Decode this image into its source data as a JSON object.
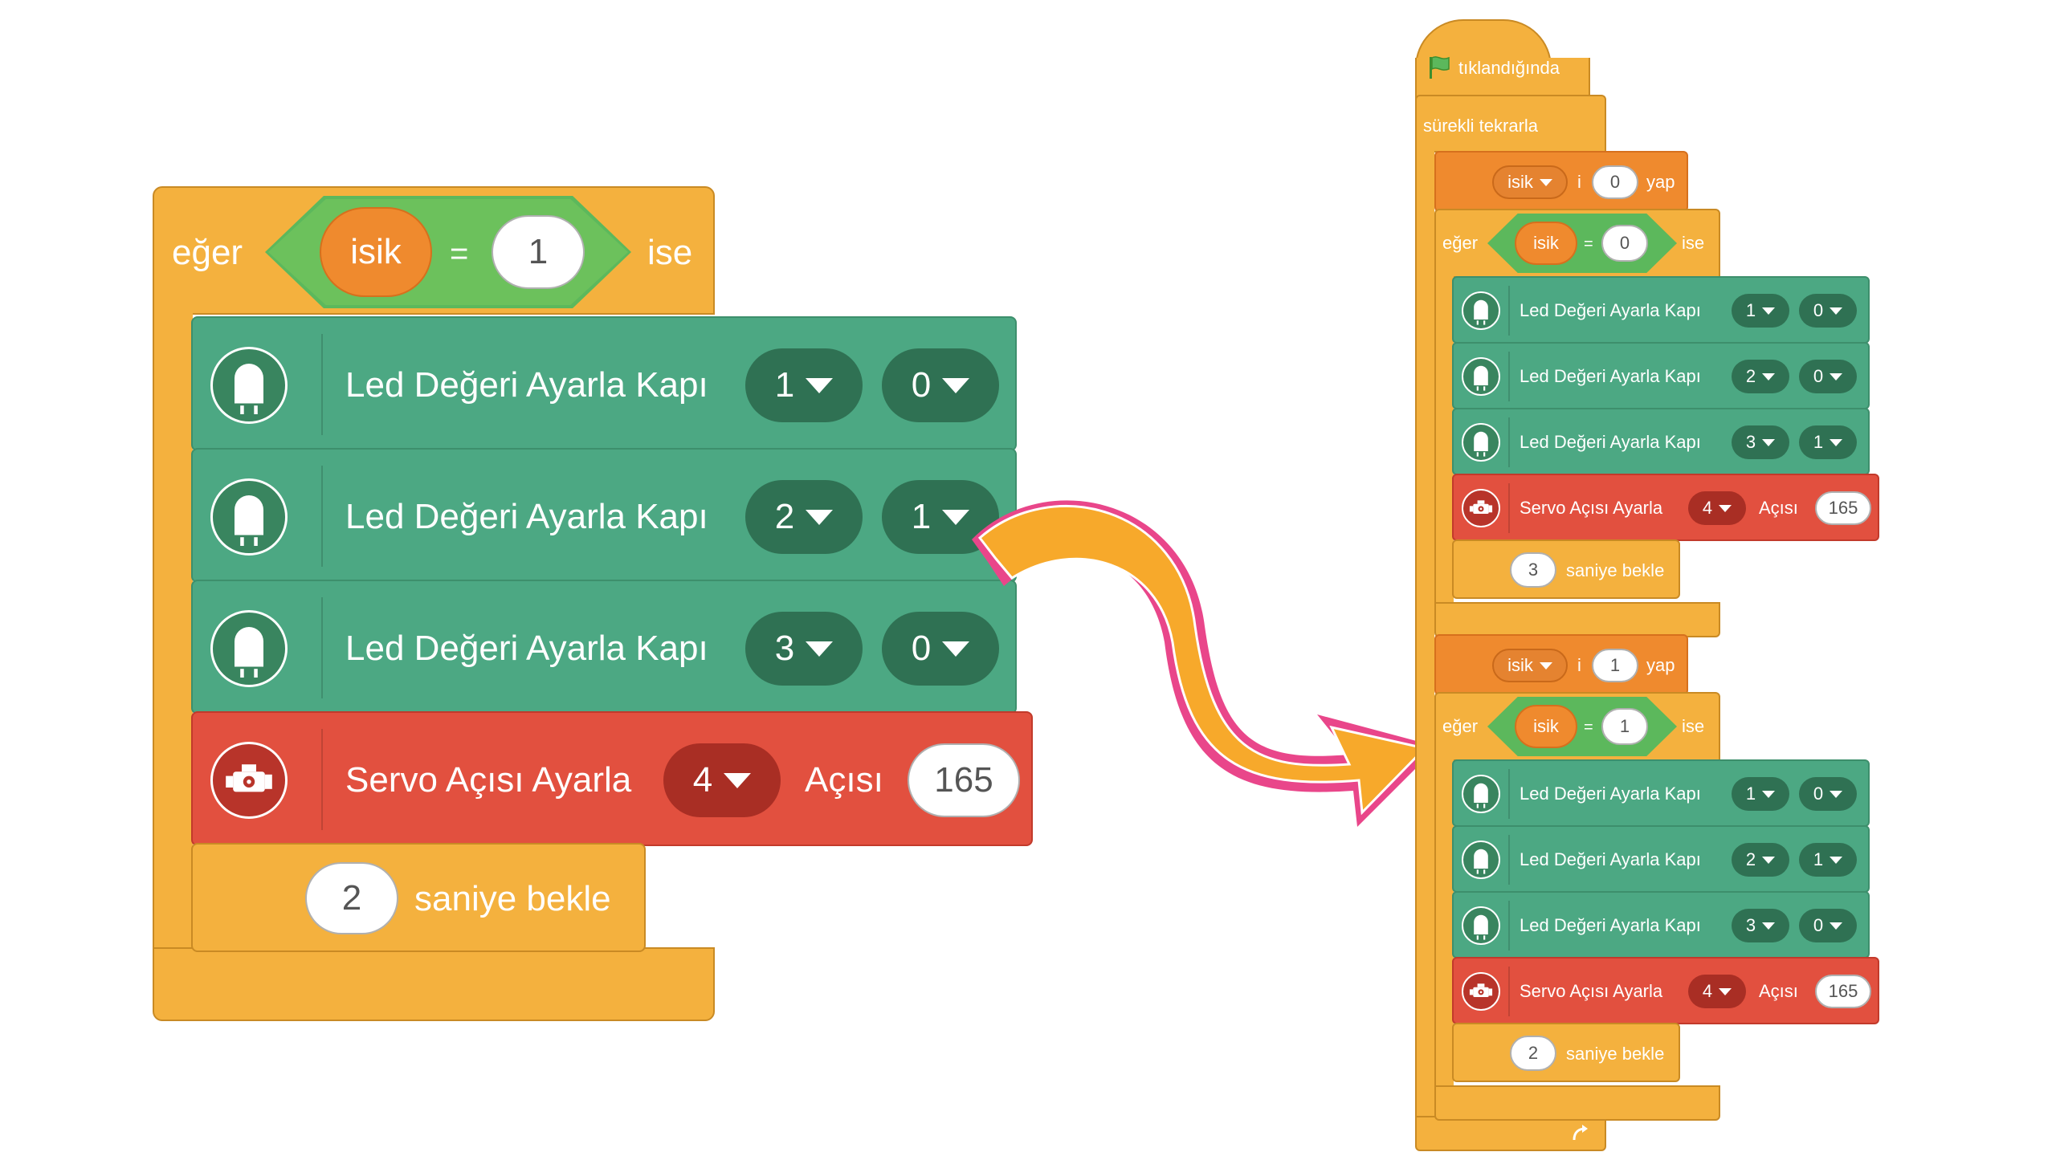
{
  "left": {
    "if_block": {
      "if_label": "eğer",
      "var": "isik",
      "op": "=",
      "value": "1",
      "then_label": "ise"
    },
    "led_blocks": [
      {
        "label": "Led Değeri Ayarla Kapı",
        "port": "1",
        "value": "0"
      },
      {
        "label": "Led Değeri Ayarla Kapı",
        "port": "2",
        "value": "1"
      },
      {
        "label": "Led Değeri Ayarla Kapı",
        "port": "3",
        "value": "0"
      }
    ],
    "servo_block": {
      "label": "Servo Açısı Ayarla",
      "port": "4",
      "angle_label": "Açısı",
      "angle": "165"
    },
    "wait_block": {
      "seconds": "2",
      "label": "saniye bekle"
    }
  },
  "right": {
    "hat": {
      "label": "tıklandığında",
      "icon": "green-flag-icon"
    },
    "forever": {
      "label": "sürekli tekrarla"
    },
    "set_var_1": {
      "var": "isik",
      "mid": "i",
      "value": "0",
      "end": "yap"
    },
    "if_1": {
      "if_label": "eğer",
      "var": "isik",
      "op": "=",
      "value": "0",
      "then_label": "ise"
    },
    "group_1": [
      {
        "label": "Led Değeri Ayarla Kapı",
        "port": "1",
        "value": "0"
      },
      {
        "label": "Led Değeri Ayarla Kapı",
        "port": "2",
        "value": "0"
      },
      {
        "label": "Led Değeri Ayarla Kapı",
        "port": "3",
        "value": "1"
      }
    ],
    "servo_1": {
      "label": "Servo Açısı Ayarla",
      "port": "4",
      "angle_label": "Açısı",
      "angle": "165"
    },
    "wait_1": {
      "seconds": "3",
      "label": "saniye bekle"
    },
    "set_var_2": {
      "var": "isik",
      "mid": "i",
      "value": "1",
      "end": "yap"
    },
    "if_2": {
      "if_label": "eğer",
      "var": "isik",
      "op": "=",
      "value": "1",
      "then_label": "ise"
    },
    "group_2": [
      {
        "label": "Led Değeri Ayarla Kapı",
        "port": "1",
        "value": "0"
      },
      {
        "label": "Led Değeri Ayarla Kapı",
        "port": "2",
        "value": "1"
      },
      {
        "label": "Led Değeri Ayarla Kapı",
        "port": "3",
        "value": "0"
      }
    ],
    "servo_2": {
      "label": "Servo Açısı Ayarla",
      "port": "4",
      "angle_label": "Açısı",
      "angle": "165"
    },
    "wait_2": {
      "seconds": "2",
      "label": "saniye bekle"
    },
    "loop_icon": "loop-arrow-icon"
  },
  "colors": {
    "control": "#f4b13e",
    "operator": "#5cb85c",
    "led": "#4ca883",
    "servo": "#e2503f",
    "variable": "#ef8a2e",
    "arrow_fill": "#f7a92b",
    "arrow_edge": "#e9468a"
  }
}
